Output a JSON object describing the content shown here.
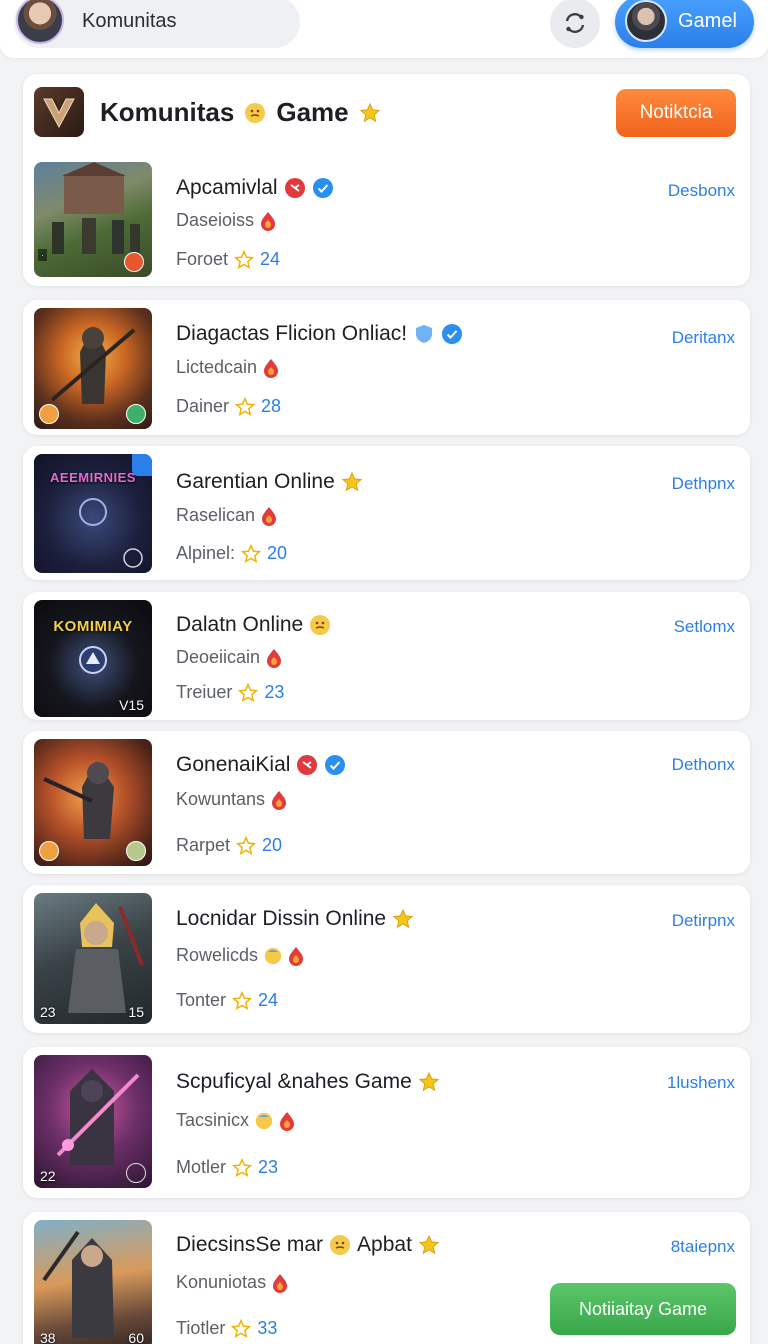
{
  "topbar": {
    "search_label": "Komunitas",
    "game_button_label": "Gamel"
  },
  "header": {
    "title_part1": "Komunitas",
    "title_part2": "Game",
    "notification_button": "Notiktcia"
  },
  "colors": {
    "accent": "#2b7fe8",
    "notify": "#f0621b",
    "success": "#38a64a",
    "star": "#f5c518"
  },
  "games": [
    {
      "title": "Apcamivlal",
      "subtitle": "Daseioiss",
      "meta_label": "Foroet",
      "rating": "24",
      "link": "Desbonx",
      "thumb_text": "",
      "icons": [
        "heart-icon",
        "verified-icon"
      ]
    },
    {
      "title": "Diagactas Flicion Onliac!",
      "subtitle": "Lictedcain",
      "meta_label": "Dainer",
      "rating": "28",
      "link": "Deritanx",
      "thumb_text": "",
      "icons": [
        "shield-icon",
        "verified-icon"
      ]
    },
    {
      "title": "Garentian Online",
      "subtitle": "Raselican",
      "meta_label": "Alpinel:",
      "rating": "20",
      "link": "Dethpnx",
      "thumb_text": "AEEMIRNIES",
      "icons": [
        "star-icon"
      ]
    },
    {
      "title": "Dalatn Online",
      "subtitle": "Deoeiicain",
      "meta_label": "Treiuer",
      "rating": "23",
      "link": "Setlomx",
      "thumb_text": "KOMIMIAY",
      "icons": [
        "emoji-icon"
      ]
    },
    {
      "title": "GonenaiKial",
      "subtitle": "Kowuntans",
      "meta_label": "Rarpet",
      "rating": "20",
      "link": "Dethonx",
      "thumb_text": "",
      "icons": [
        "heart-icon",
        "verified-icon"
      ]
    },
    {
      "title": "Locnidar Dissin Online",
      "subtitle": "Rowelicds",
      "meta_label": "Tonter",
      "rating": "24",
      "link": "Detirpnx",
      "thumb_text": "",
      "icons": [
        "star-icon"
      ]
    },
    {
      "title": "Scpuficyal &nahes Game",
      "subtitle": "Tacsinicx",
      "meta_label": "Motler",
      "rating": "23",
      "link": "1lushenx",
      "thumb_text": "",
      "icons": [
        "star-icon"
      ]
    },
    {
      "title": "DiecsinsSe mar",
      "title_suffix": "Apbat",
      "subtitle": "Konuniotas",
      "meta_label": "Tiotler",
      "rating": "33",
      "link": "8taiepnx",
      "thumb_text": "",
      "icons": [
        "emoji-icon",
        "star-icon"
      ],
      "cta": "Notiiaitay Game"
    }
  ],
  "thumb_numbers": {
    "card1_badge": "3",
    "card4_label": "V15",
    "card6_left": "23",
    "card6_right": "15",
    "card7_left": "22",
    "card8_left": "38",
    "card8_right": "60"
  }
}
